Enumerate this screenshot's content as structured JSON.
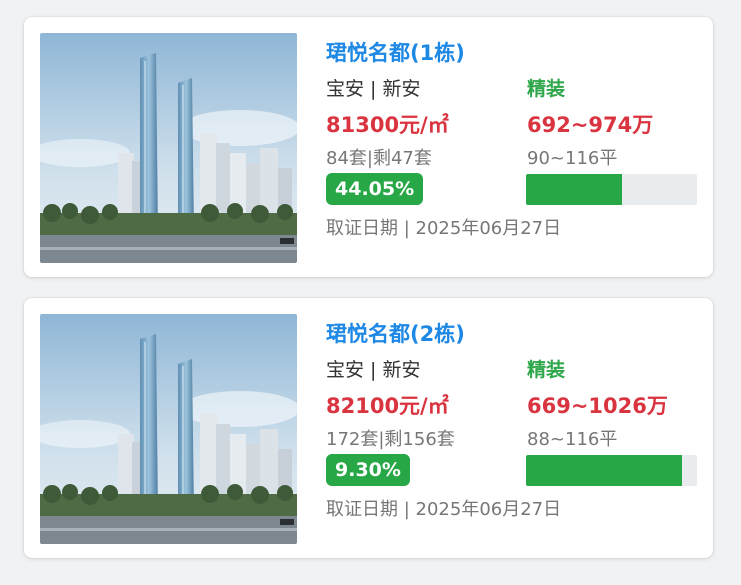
{
  "listings": [
    {
      "title": "珺悦名都(1栋)",
      "location": "宝安 | 新安",
      "decoration": "精装",
      "unit_price": "81300元/㎡",
      "total_price": "692~974万",
      "units": "84套|剩47套",
      "area": "90~116平",
      "sold_percent": "44.05%",
      "progress_fraction": 0.56,
      "permit_date": "取证日期 | 2025年06月27日"
    },
    {
      "title": "珺悦名都(2栋)",
      "location": "宝安 | 新安",
      "decoration": "精装",
      "unit_price": "82100元/㎡",
      "total_price": "669~1026万",
      "units": "172套|剩156套",
      "area": "88~116平",
      "sold_percent": "9.30%",
      "progress_fraction": 0.91,
      "permit_date": "取证日期 | 2025年06月27日"
    }
  ],
  "colors": {
    "title": "#1e88e5",
    "price": "#d9343f",
    "decoration": "#2ea64a",
    "badge": "#27a745",
    "bar_track": "#e9ecef"
  }
}
